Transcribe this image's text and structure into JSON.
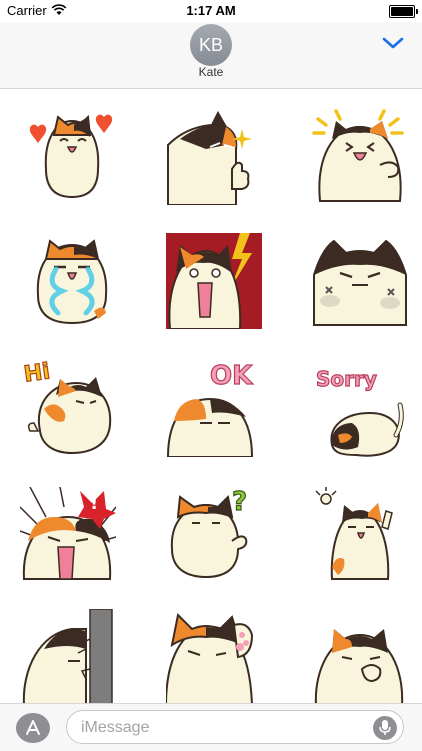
{
  "status_bar": {
    "carrier": "Carrier",
    "time": "1:17 AM",
    "battery_level": 1.0
  },
  "header": {
    "avatar_initials": "KB",
    "contact_name": "Kate",
    "collapse_icon": "chevron-down-icon",
    "accent_color": "#1a6ee6"
  },
  "stickers": [
    {
      "id": "love",
      "icon": "cat-hearts-sticker"
    },
    {
      "id": "thumbs-up",
      "icon": "cat-thumbs-up-sticker"
    },
    {
      "id": "excited",
      "icon": "cat-excited-sticker"
    },
    {
      "id": "crying",
      "icon": "cat-crying-sticker"
    },
    {
      "id": "shocked",
      "icon": "cat-shocked-sticker"
    },
    {
      "id": "angry",
      "icon": "cat-angry-sticker"
    },
    {
      "id": "hi",
      "icon": "cat-hi-sticker",
      "text": "Hi"
    },
    {
      "id": "ok",
      "icon": "cat-ok-sticker",
      "text": "OK"
    },
    {
      "id": "sorry",
      "icon": "cat-sorry-sticker",
      "text": "Sorry"
    },
    {
      "id": "alarm",
      "icon": "cat-alarm-sticker",
      "text": "!"
    },
    {
      "id": "question",
      "icon": "cat-question-sticker",
      "text": "?"
    },
    {
      "id": "idea",
      "icon": "cat-idea-sticker"
    },
    {
      "id": "peek",
      "icon": "cat-peek-sticker"
    },
    {
      "id": "paw",
      "icon": "cat-paw-sticker"
    },
    {
      "id": "giggle",
      "icon": "cat-giggle-sticker"
    }
  ],
  "input_bar": {
    "apps_icon": "app-store-icon",
    "placeholder": "iMessage",
    "mic_icon": "microphone-icon"
  },
  "colors": {
    "cat_body": "#f8f5dc",
    "cat_orange": "#ee8a2d",
    "cat_dark": "#3b2b22"
  }
}
